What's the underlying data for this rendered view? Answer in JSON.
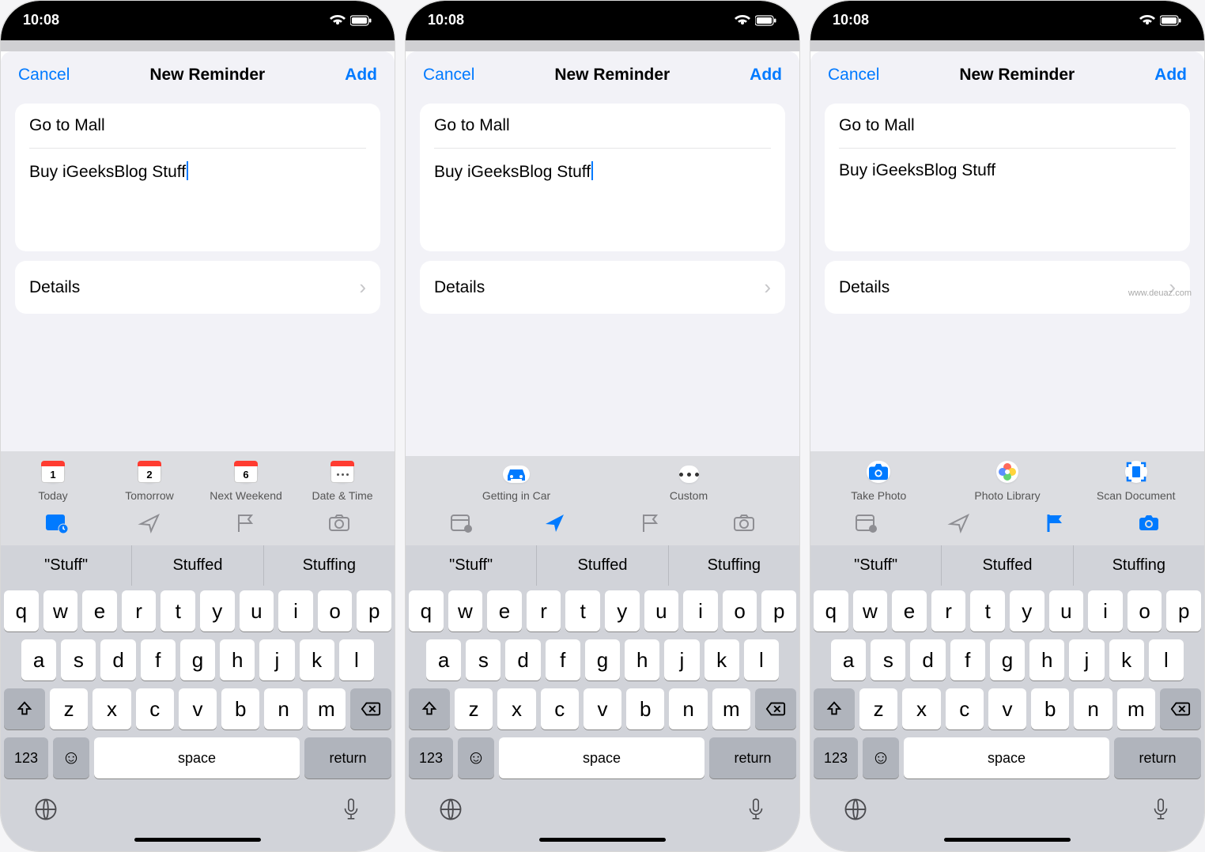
{
  "status": {
    "time": "10:08"
  },
  "nav": {
    "cancel": "Cancel",
    "title": "New Reminder",
    "add": "Add"
  },
  "reminder": {
    "title": "Go to Mall",
    "notes": "Buy iGeeksBlog Stuff"
  },
  "details": {
    "label": "Details"
  },
  "chips": {
    "date": [
      {
        "day": "1",
        "label": "Today"
      },
      {
        "day": "2",
        "label": "Tomorrow"
      },
      {
        "day": "6",
        "label": "Next Weekend"
      },
      {
        "day": "",
        "label": "Date & Time"
      }
    ],
    "location": [
      {
        "label": "Getting in Car"
      },
      {
        "label": "Custom"
      }
    ],
    "photo": [
      {
        "label": "Take Photo"
      },
      {
        "label": "Photo Library"
      },
      {
        "label": "Scan Document"
      }
    ]
  },
  "suggestions": [
    "\"Stuff\"",
    "Stuffed",
    "Stuffing"
  ],
  "keyboard": {
    "row1": [
      "q",
      "w",
      "e",
      "r",
      "t",
      "y",
      "u",
      "i",
      "o",
      "p"
    ],
    "row2": [
      "a",
      "s",
      "d",
      "f",
      "g",
      "h",
      "j",
      "k",
      "l"
    ],
    "row3": [
      "z",
      "x",
      "c",
      "v",
      "b",
      "n",
      "m"
    ],
    "num": "123",
    "space": "space",
    "return": "return"
  },
  "watermark": "www.deuaz.com"
}
